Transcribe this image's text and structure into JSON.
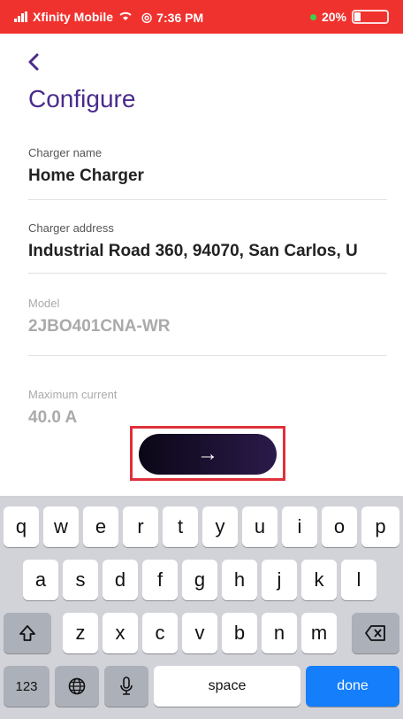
{
  "status_bar": {
    "carrier": "Xfinity Mobile",
    "time": "7:36 PM",
    "battery": "20%"
  },
  "page": {
    "title": "Configure"
  },
  "fields": {
    "charger_name": {
      "label": "Charger name",
      "value": "Home Charger"
    },
    "charger_address": {
      "label": "Charger address",
      "value": "Industrial Road 360, 94070, San Carlos, U"
    },
    "model": {
      "label": "Model",
      "value": "2JBO401CNA-WR"
    },
    "max_current": {
      "label": "Maximum current",
      "value": "40.0 A"
    }
  },
  "next_button": {
    "icon": "arrow-right-icon",
    "glyph": "→"
  },
  "keyboard": {
    "row1": [
      "q",
      "w",
      "e",
      "r",
      "t",
      "y",
      "u",
      "i",
      "o",
      "p"
    ],
    "row2": [
      "a",
      "s",
      "d",
      "f",
      "g",
      "h",
      "j",
      "k",
      "l"
    ],
    "row3": [
      "z",
      "x",
      "c",
      "v",
      "b",
      "n",
      "m"
    ],
    "numbers_label": "123",
    "space_label": "space",
    "done_label": "done"
  },
  "colors": {
    "status_bar": "#f0322e",
    "accent": "#4a2b8c",
    "done": "#147efb",
    "highlight": "#e0303a"
  }
}
